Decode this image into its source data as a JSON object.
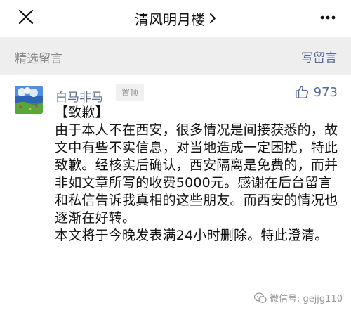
{
  "header": {
    "title": "清风明月楼",
    "close_icon": "close-icon",
    "more_icon": "more-dots-icon"
  },
  "section": {
    "title": "精选留言",
    "write_label": "写留言"
  },
  "comment": {
    "author": "白马非马",
    "pinned_label": "置顶",
    "likes": "973",
    "text": "【致歉】\n由于本人不在西安，很多情况是间接获悉的，故文中有些不实信息，对当地造成一定困扰，特此致歉。经核实后确认，西安隔离是免费的，而并非如文章所写的收费5000元。感谢在后台留言和私信告诉我真相的这些朋友。而西安的情况也逐渐在好转。\n本文将于今晚发表满24小时删除。特此澄清。"
  },
  "watermark": {
    "text": "微信号: gejjg110"
  },
  "colors": {
    "link": "#566b95",
    "muted": "#8a8a8a",
    "section_bg": "#eeeeee"
  }
}
